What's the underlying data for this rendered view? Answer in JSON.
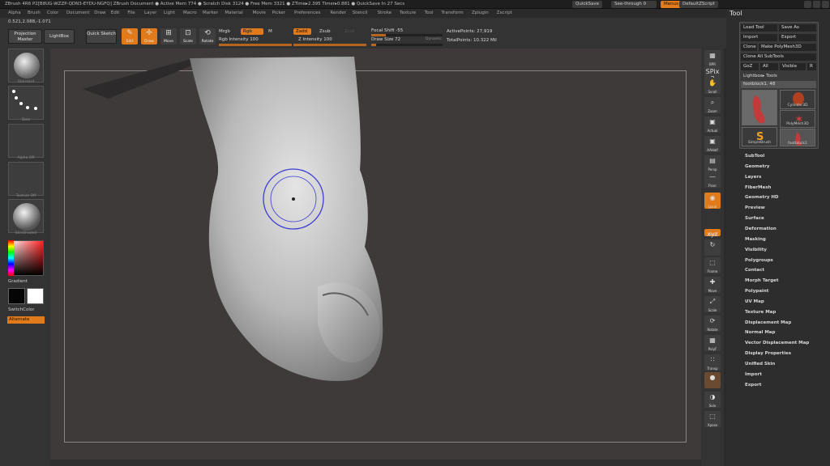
{
  "title_bar": {
    "info": "ZBrush 4R6  P2[B8UG-WZZP-QDN3-EYDU-NGFQ]   ZBrush Document    ● Active Mem 774 ● Scratch Disk 3124 ● Free Mem 3321 ● ZTime▸2.395 Timer▸0.881 ● QuickSave In 27 Secs",
    "quicksave": "QuickSave",
    "see_through": "See-through  0",
    "menus_btn": "Menus",
    "default_zscript": "DefaultZScript"
  },
  "menu_bar": [
    "Alpha",
    "Brush",
    "Color",
    "Document",
    "Draw",
    "Edit",
    "File",
    "Layer",
    "Light",
    "Macro",
    "Marker",
    "Material",
    "Movie",
    "Picker",
    "Preferences",
    "Render",
    "Stencil",
    "Stroke",
    "Texture",
    "Tool",
    "Transform",
    "Zplugin",
    "Zscript"
  ],
  "coords": "0.521,2.088,-1.071",
  "shelf": {
    "projection_master": "Projection Master",
    "lightbox": "LightBox",
    "quick_sketch": "Quick Sketch",
    "edit": "Edit",
    "draw": "Draw",
    "move": "Move",
    "scale": "Scale",
    "rotate": "Rotate",
    "mrgb": "Mrgb",
    "rgb": "Rgb",
    "m": "M",
    "rgb_intensity": "Rgb Intensity 100",
    "zadd": "Zadd",
    "zsub": "Zsub",
    "zcut": "Zcut",
    "z_intensity": "Z Intensity 100",
    "focal_shift": "Focal Shift -55",
    "draw_size": "Draw Size 72",
    "dynamic": "Dynamic",
    "active_points": "ActivePoints: 27,919",
    "total_points": "TotalPoints: 10.322 Mil",
    "rgb_intensity_value": 1.0,
    "z_intensity_value": 1.0,
    "focal_shift_value": 0.2,
    "draw_size_value": 0.07
  },
  "left_panel": {
    "brush_label": "Standard",
    "stroke_label": "Dots",
    "alpha_label": "Alpha Off",
    "texture_label": "Texture Off",
    "material_label": "SkinShade4",
    "gradient": "Gradient",
    "switch_color": "SwitchColor",
    "alternate": "Alternate"
  },
  "right_strip": [
    {
      "glyph": "▦",
      "label": "BPR"
    },
    {
      "glyph": "SPix 3",
      "label": ""
    },
    {
      "glyph": "✋",
      "label": "Scroll"
    },
    {
      "glyph": "⌕",
      "label": "Zoom"
    },
    {
      "glyph": "▣",
      "label": "Actual"
    },
    {
      "glyph": "▣",
      "label": "AAHalf"
    },
    {
      "glyph": "▤",
      "label": "Persp"
    },
    {
      "glyph": "—",
      "label": "Floor"
    },
    {
      "glyph": "◉",
      "label": "Local"
    },
    {
      "glyph": "xyz",
      "label": "Gxyz"
    },
    {
      "glyph": "↻",
      "label": ""
    },
    {
      "glyph": "⬚",
      "label": "Frame"
    },
    {
      "glyph": "✚",
      "label": "Move"
    },
    {
      "glyph": "⤢",
      "label": "Scale"
    },
    {
      "glyph": "⟳",
      "label": "Rotate"
    },
    {
      "glyph": "▦",
      "label": "PolyF"
    },
    {
      "glyph": "∷",
      "label": "Transp"
    },
    {
      "glyph": "●",
      "label": ""
    },
    {
      "glyph": "◑",
      "label": "Solo"
    },
    {
      "glyph": "⬚",
      "label": "Xpose"
    }
  ],
  "tool_palette": {
    "header": "Tool",
    "load_tool": "Load Tool",
    "save_as": "Save As",
    "import": "Import",
    "export": "Export",
    "clone": "Clone",
    "make_polymesh": "Make PolyMesh3D",
    "clone_all": "Clone All SubTools",
    "goz": "GoZ",
    "all": "All",
    "visible": "Visible",
    "r": "R",
    "lightbox_tools": "Lightbox▸ Tools",
    "current_tool": "footblock1. 48",
    "thumbs": [
      "footblock1",
      "Cylinder3D",
      "PolyMesh3D",
      "SimpleBrush",
      "footblock1"
    ],
    "menu_items": [
      "SubTool",
      "Geometry",
      "Layers",
      "FiberMesh",
      "Geometry HD",
      "Preview",
      "Surface",
      "Deformation",
      "Masking",
      "Visibility",
      "Polygroups",
      "Contact",
      "Morph Target",
      "Polypaint",
      "UV Map",
      "Texture Map",
      "Displacement Map",
      "Normal Map",
      "Vector Displacement Map",
      "Display Properties",
      "Unified Skin",
      "Import",
      "Export"
    ]
  },
  "colors": {
    "accent": "#e07a1a",
    "canvas_bg": "#3f3a3a",
    "brush_cursor": "#3b3bd4"
  }
}
